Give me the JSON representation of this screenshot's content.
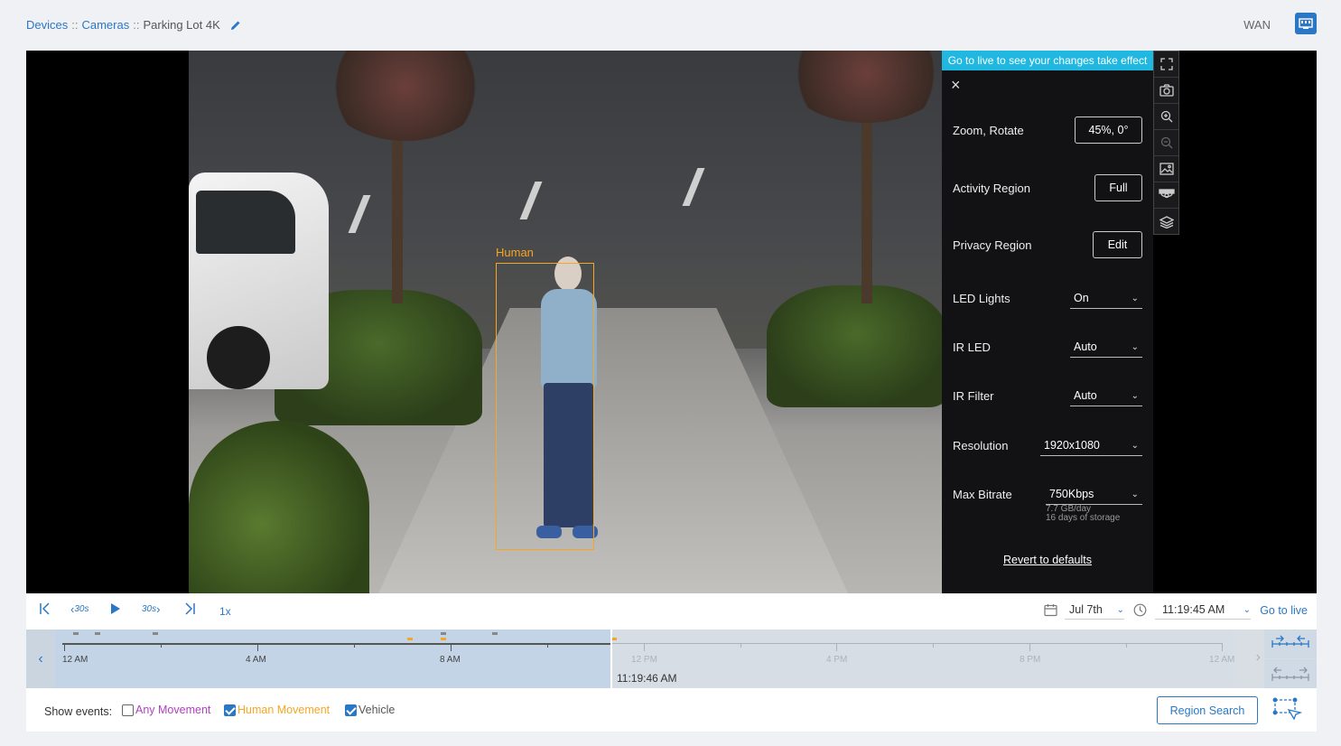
{
  "header": {
    "breadcrumb": {
      "devices": "Devices",
      "sep1": "::",
      "cameras": "Cameras",
      "sep2": "::",
      "current": "Parking Lot 4K"
    },
    "network_label": "WAN",
    "accent_color": "#2a78c5"
  },
  "video": {
    "detection_label": "Human",
    "detection_color": "#f5a623"
  },
  "settings_panel": {
    "banner": "Go to live to see your changes take effect",
    "banner_color": "#20b8e0",
    "rows": {
      "zoom_rotate": {
        "label": "Zoom, Rotate",
        "value": "45%, 0°"
      },
      "activity_region": {
        "label": "Activity Region",
        "value": "Full"
      },
      "privacy_region": {
        "label": "Privacy Region",
        "value": "Edit"
      },
      "led_lights": {
        "label": "LED Lights",
        "value": "On"
      },
      "ir_led": {
        "label": "IR LED",
        "value": "Auto"
      },
      "ir_filter": {
        "label": "IR Filter",
        "value": "Auto"
      },
      "resolution": {
        "label": "Resolution",
        "value": "1920x1080"
      },
      "max_bitrate": {
        "label": "Max Bitrate",
        "value": "750Kbps",
        "sub1": "7.7 GB/day",
        "sub2": "16 days of storage"
      }
    },
    "revert": "Revert to defaults"
  },
  "toolbar": {
    "icons": [
      "fullscreen-icon",
      "camera-snapshot-icon",
      "zoom-in-icon",
      "zoom-out-icon",
      "image-settings-icon",
      "camera-settings-icon",
      "layers-icon"
    ]
  },
  "playback": {
    "skip_back": "30s",
    "skip_forward": "30s",
    "speed": "1x",
    "date": "Jul 7th",
    "time": "11:19:45 AM",
    "go_live": "Go to live"
  },
  "timeline": {
    "labels_past": [
      "12 AM",
      "4 AM",
      "8 AM"
    ],
    "labels_future": [
      "12 PM",
      "4 PM",
      "8 PM",
      "12 AM"
    ],
    "cursor_time": "11:19:46 AM"
  },
  "events": {
    "label": "Show events:",
    "any_movement": {
      "label": "Any Movement",
      "checked": false,
      "color": "#b040c0"
    },
    "human_movement": {
      "label": "Human Movement",
      "checked": true,
      "color": "#f5a623"
    },
    "vehicle": {
      "label": "Vehicle",
      "checked": true,
      "color": "#555555"
    },
    "region_search": "Region Search"
  }
}
